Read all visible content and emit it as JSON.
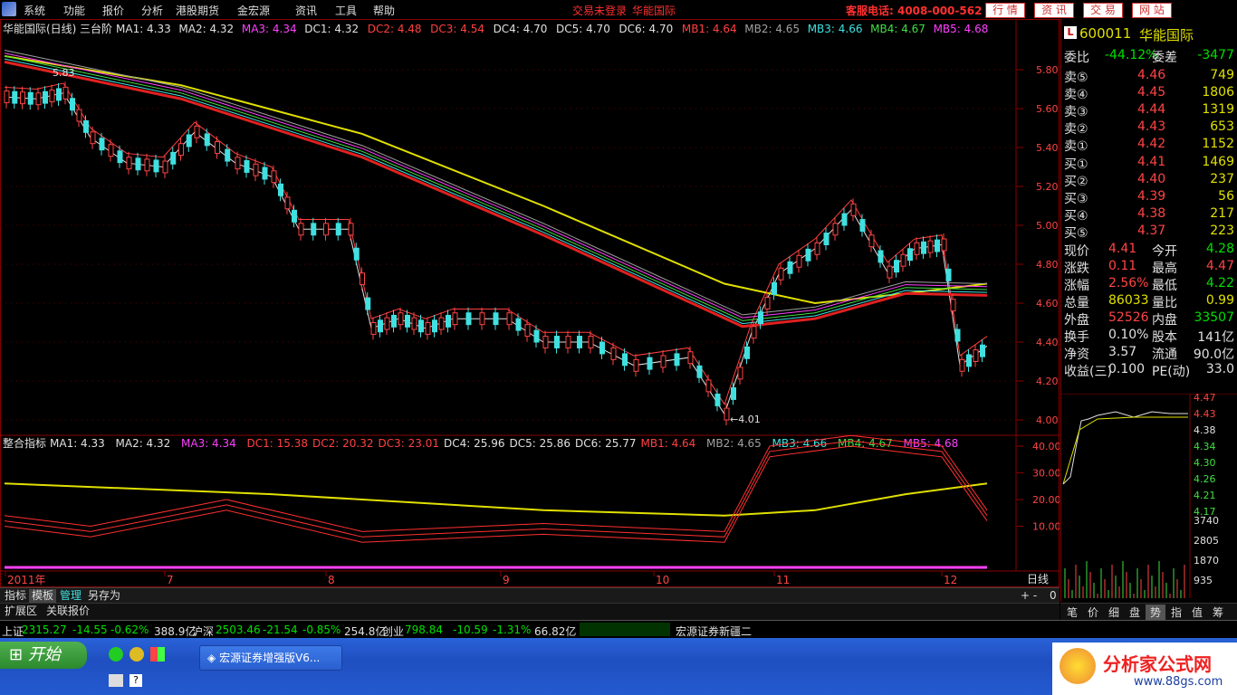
{
  "menu": {
    "items": [
      "系统",
      "功能",
      "报价",
      "分析",
      "港股期货",
      "金宏源",
      "资讯",
      "工具",
      "帮助"
    ],
    "status_left": "交易未登录",
    "status_stock": "华能国际",
    "service_phone": "客服电话: 4008-000-562",
    "buttons": [
      "行 情",
      "资 讯",
      "交 易",
      "网 站"
    ]
  },
  "kline": {
    "title": "华能国际(日线)",
    "mode": "三台阶",
    "indicators": [
      {
        "label": "MA1: 4.33",
        "color": "#e0e0e0"
      },
      {
        "label": "MA2: 4.32",
        "color": "#e0e0e0"
      },
      {
        "label": "MA3: 4.34",
        "color": "#ff40ff"
      },
      {
        "label": "DC1: 4.32",
        "color": "#e0e0e0"
      },
      {
        "label": "DC2: 4.48",
        "color": "#ff4040"
      },
      {
        "label": "DC3: 4.54",
        "color": "#ff4040"
      },
      {
        "label": "DC4: 4.70",
        "color": "#e0e0e0"
      },
      {
        "label": "DC5: 4.70",
        "color": "#e0e0e0"
      },
      {
        "label": "DC6: 4.70",
        "color": "#e0e0e0"
      },
      {
        "label": "MB1: 4.64",
        "color": "#ff4040"
      },
      {
        "label": "MB2: 4.65",
        "color": "#a0a0a0"
      },
      {
        "label": "MB3: 4.66",
        "color": "#40e0e0"
      },
      {
        "label": "MB4: 4.67",
        "color": "#40e040"
      },
      {
        "label": "MB5: 4.68",
        "color": "#ff40ff"
      }
    ],
    "price_ticks": [
      "5.80",
      "5.60",
      "5.40",
      "5.20",
      "5.00",
      "4.80",
      "4.60",
      "4.40",
      "4.20",
      "4.00"
    ],
    "high_label": "5.83",
    "low_label": "←4.01"
  },
  "sub_chart": {
    "title": "整合指标",
    "indicators": [
      {
        "label": "MA1: 4.33",
        "color": "#e0e0e0"
      },
      {
        "label": "MA2: 4.32",
        "color": "#e0e0e0"
      },
      {
        "label": "MA3: 4.34",
        "color": "#ff40ff"
      },
      {
        "label": "DC1: 15.38",
        "color": "#ff4040"
      },
      {
        "label": "DC2: 20.32",
        "color": "#ff4040"
      },
      {
        "label": "DC3: 23.01",
        "color": "#ff4040"
      },
      {
        "label": "DC4: 25.96",
        "color": "#e0e0e0"
      },
      {
        "label": "DC5: 25.86",
        "color": "#e0e0e0"
      },
      {
        "label": "DC6: 25.77",
        "color": "#e0e0e0"
      },
      {
        "label": "MB1: 4.64",
        "color": "#ff4040"
      },
      {
        "label": "MB2: 4.65",
        "color": "#a0a0a0"
      },
      {
        "label": "MB3: 4.66",
        "color": "#40e0e0"
      },
      {
        "label": "MB4: 4.67",
        "color": "#40e040"
      },
      {
        "label": "MB5: 4.68",
        "color": "#ff40ff"
      }
    ],
    "ticks": [
      "40.00",
      "30.00",
      "20.00",
      "10.00"
    ]
  },
  "time_axis": {
    "labels": [
      "2011年",
      "7",
      "8",
      "9",
      "10",
      "11",
      "12"
    ],
    "period": "日线"
  },
  "bottom_tabs": [
    "指标",
    "模板",
    "管理",
    "另存为"
  ],
  "bottom_tabs2": [
    "扩展区",
    "关联报价"
  ],
  "quote": {
    "code": "600011",
    "name": "华能国际",
    "weibi_label": "委比",
    "weibi": "-44.12%",
    "weicha_label": "委差",
    "weicha": "-3477",
    "asks": [
      {
        "label": "卖⑤",
        "price": "4.46",
        "vol": "749"
      },
      {
        "label": "卖④",
        "price": "4.45",
        "vol": "1806"
      },
      {
        "label": "卖③",
        "price": "4.44",
        "vol": "1319"
      },
      {
        "label": "卖②",
        "price": "4.43",
        "vol": "653"
      },
      {
        "label": "卖①",
        "price": "4.42",
        "vol": "1152"
      }
    ],
    "bids": [
      {
        "label": "买①",
        "price": "4.41",
        "vol": "1469"
      },
      {
        "label": "买②",
        "price": "4.40",
        "vol": "237"
      },
      {
        "label": "买③",
        "price": "4.39",
        "vol": "56"
      },
      {
        "label": "买④",
        "price": "4.38",
        "vol": "217"
      },
      {
        "label": "买⑤",
        "price": "4.37",
        "vol": "223"
      }
    ],
    "stats": [
      {
        "l1": "现价",
        "v1": "4.41",
        "c1": "#ff4444",
        "l2": "今开",
        "v2": "4.28",
        "c2": "#00e000"
      },
      {
        "l1": "涨跌",
        "v1": "0.11",
        "c1": "#ff4444",
        "l2": "最高",
        "v2": "4.47",
        "c2": "#ff4444"
      },
      {
        "l1": "涨幅",
        "v1": "2.56%",
        "c1": "#ff4444",
        "l2": "最低",
        "v2": "4.22",
        "c2": "#00e000"
      },
      {
        "l1": "总量",
        "v1": "86033",
        "c1": "#e0e000",
        "l2": "量比",
        "v2": "0.99",
        "c2": "#e0e000"
      },
      {
        "l1": "外盘",
        "v1": "52526",
        "c1": "#ff4444",
        "l2": "内盘",
        "v2": "33507",
        "c2": "#00e000"
      },
      {
        "l1": "换手",
        "v1": "0.10%",
        "c1": "#e0e0e0",
        "l2": "股本",
        "v2": "141亿",
        "c2": "#e0e0e0"
      },
      {
        "l1": "净资",
        "v1": "3.57",
        "c1": "#e0e0e0",
        "l2": "流通",
        "v2": "90.0亿",
        "c2": "#e0e0e0"
      },
      {
        "l1": "收益(三)",
        "v1": "0.100",
        "c1": "#e0e0e0",
        "l2": "PE(动)",
        "v2": "33.0",
        "c2": "#e0e0e0"
      }
    ],
    "mini_ticks": [
      "4.47",
      "4.43",
      "4.38",
      "4.34",
      "4.30",
      "4.26",
      "4.21",
      "4.17",
      "3740",
      "2805",
      "1870",
      "935"
    ]
  },
  "side_tabs": [
    "笔",
    "价",
    "细",
    "盘",
    "势",
    "指",
    "值",
    "筹"
  ],
  "status_bar": [
    {
      "text": "上证",
      "color": "#e0e0e0"
    },
    {
      "text": "2315.27",
      "color": "#00e000"
    },
    {
      "text": "-14.55",
      "color": "#00e000"
    },
    {
      "text": "-0.62%",
      "color": "#00e000"
    },
    {
      "text": "388.9亿",
      "color": "#e0e0e0"
    },
    {
      "text": "沪深",
      "color": "#e0e0e0"
    },
    {
      "text": "2503.46",
      "color": "#00e000"
    },
    {
      "text": "-21.54",
      "color": "#00e000"
    },
    {
      "text": "-0.85%",
      "color": "#00e000"
    },
    {
      "text": "254.8亿",
      "color": "#e0e0e0"
    },
    {
      "text": "创业",
      "color": "#e0e0e0"
    },
    {
      "text": "798.84",
      "color": "#00e000"
    },
    {
      "text": "-10.59",
      "color": "#00e000"
    },
    {
      "text": "-1.31%",
      "color": "#00e000"
    },
    {
      "text": "66.82亿",
      "color": "#e0e0e0"
    }
  ],
  "status_right": "宏源证券新疆二",
  "taskbar": {
    "start": "开始",
    "item": "宏源证券增强版V6..."
  },
  "watermark": {
    "text": "分析家公式网",
    "url": "www.88gs.com"
  },
  "colors": {
    "up": "#ff4444",
    "down": "#40e0e0",
    "yellow": "#e0e000",
    "bg": "#000000"
  }
}
